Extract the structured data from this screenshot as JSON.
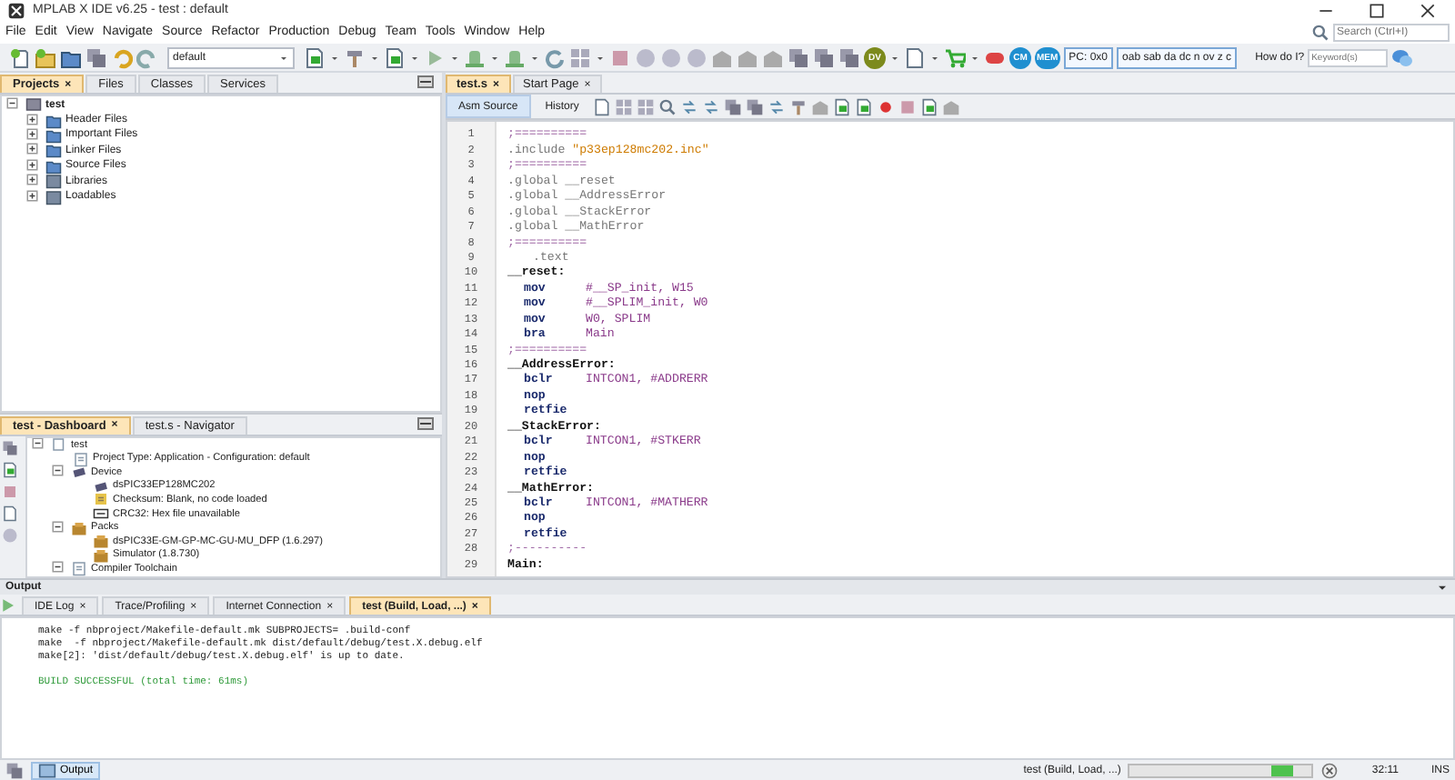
{
  "window": {
    "title": "MPLAB X IDE v6.25 - test : default"
  },
  "menu": [
    "File",
    "Edit",
    "View",
    "Navigate",
    "Source",
    "Refactor",
    "Production",
    "Debug",
    "Team",
    "Tools",
    "Window",
    "Help"
  ],
  "search": {
    "placeholder": "Search (Ctrl+I)"
  },
  "toolbar": {
    "configuration": "default",
    "badges": [
      "DV",
      "CM",
      "MEM"
    ],
    "pc": "PC: 0x0",
    "status_flags": "oab sab da dc n ov z c",
    "help_label": "How do I?",
    "help_placeholder": "Keyword(s)"
  },
  "projects_panel": {
    "tabs": [
      {
        "label": "Projects",
        "selected": true,
        "close": "×"
      },
      {
        "label": "Files",
        "selected": false
      },
      {
        "label": "Classes",
        "selected": false
      },
      {
        "label": "Services",
        "selected": false
      }
    ],
    "tree": {
      "label": "test",
      "kind": "project",
      "expanded": true,
      "children": [
        {
          "label": "Header Files",
          "kind": "folder",
          "expanded": false
        },
        {
          "label": "Important Files",
          "kind": "folder",
          "expanded": false
        },
        {
          "label": "Linker Files",
          "kind": "folder",
          "expanded": false
        },
        {
          "label": "Source Files",
          "kind": "folder",
          "expanded": false
        },
        {
          "label": "Libraries",
          "kind": "library",
          "expanded": false
        },
        {
          "label": "Loadables",
          "kind": "library",
          "expanded": false
        }
      ]
    }
  },
  "dashboard_panel": {
    "tabs": [
      {
        "label": "test - Dashboard",
        "selected": true,
        "close": "×"
      },
      {
        "label": "test.s - Navigator",
        "selected": false
      }
    ],
    "tree": {
      "label": "test",
      "kind": "root",
      "expanded": true,
      "children": [
        {
          "label": "Project Type: Application - Configuration: default",
          "kind": "info"
        },
        {
          "label": "Device",
          "kind": "chip",
          "expanded": true,
          "children": [
            {
              "label": "dsPIC33EP128MC202",
              "kind": "chip"
            },
            {
              "label": "Checksum: Blank, no code loaded",
              "kind": "checksum"
            },
            {
              "label": "CRC32: Hex file unavailable",
              "kind": "crc"
            }
          ]
        },
        {
          "label": "Packs",
          "kind": "pack",
          "expanded": true,
          "children": [
            {
              "label": "dsPIC33E-GM-GP-MC-GU-MU_DFP (1.6.297)",
              "kind": "pack"
            },
            {
              "label": "Simulator (1.8.730)",
              "kind": "pack"
            }
          ]
        },
        {
          "label": "Compiler Toolchain",
          "kind": "info",
          "expanded": true
        }
      ]
    }
  },
  "editor": {
    "tabs": [
      {
        "label": "test.s",
        "selected": true,
        "close": "×"
      },
      {
        "label": "Start Page",
        "selected": false,
        "close": "×"
      }
    ],
    "views": [
      {
        "label": "Asm Source",
        "selected": true
      },
      {
        "label": "History",
        "selected": false
      }
    ],
    "lines": [
      {
        "number": "1",
        "kind": "comment",
        "text": ";=========="
      },
      {
        "number": "2",
        "kind": "include",
        "directive": ".include",
        "argument": "\"p33ep128mc202.inc\""
      },
      {
        "number": "3",
        "kind": "comment",
        "text": ";=========="
      },
      {
        "number": "4",
        "kind": "directive",
        "text": ".global __reset"
      },
      {
        "number": "5",
        "kind": "directive",
        "text": ".global __AddressError"
      },
      {
        "number": "6",
        "kind": "directive",
        "text": ".global __StackError"
      },
      {
        "number": "7",
        "kind": "directive",
        "text": ".global __MathError"
      },
      {
        "number": "8",
        "kind": "comment",
        "text": ";=========="
      },
      {
        "number": "9",
        "kind": "section",
        "text": ".text"
      },
      {
        "number": "10",
        "kind": "label",
        "text": "__reset:"
      },
      {
        "number": "11",
        "kind": "instr",
        "mnemonic": "mov",
        "operands": "#__SP_init, W15"
      },
      {
        "number": "12",
        "kind": "instr",
        "mnemonic": "mov",
        "operands": "#__SPLIM_init, W0"
      },
      {
        "number": "13",
        "kind": "instr",
        "mnemonic": "mov",
        "operands": "W0, SPLIM"
      },
      {
        "number": "14",
        "kind": "instr",
        "mnemonic": "bra",
        "operands": "Main"
      },
      {
        "number": "15",
        "kind": "comment",
        "text": ";=========="
      },
      {
        "number": "16",
        "kind": "label",
        "text": "__AddressError:"
      },
      {
        "number": "17",
        "kind": "instr",
        "mnemonic": "bclr",
        "operands": "INTCON1, #ADDRERR"
      },
      {
        "number": "18",
        "kind": "instr",
        "mnemonic": "nop"
      },
      {
        "number": "19",
        "kind": "instr",
        "mnemonic": "retfie"
      },
      {
        "number": "20",
        "kind": "label",
        "text": "__StackError:"
      },
      {
        "number": "21",
        "kind": "instr",
        "mnemonic": "bclr",
        "operands": "INTCON1, #STKERR"
      },
      {
        "number": "22",
        "kind": "instr",
        "mnemonic": "nop"
      },
      {
        "number": "23",
        "kind": "instr",
        "mnemonic": "retfie"
      },
      {
        "number": "24",
        "kind": "label",
        "text": "__MathError:"
      },
      {
        "number": "25",
        "kind": "instr",
        "mnemonic": "bclr",
        "operands": "INTCON1, #MATHERR"
      },
      {
        "number": "26",
        "kind": "instr",
        "mnemonic": "nop"
      },
      {
        "number": "27",
        "kind": "instr",
        "mnemonic": "retfie"
      },
      {
        "number": "28",
        "kind": "comment",
        "text": ";----------"
      },
      {
        "number": "29",
        "kind": "label",
        "text": "Main:"
      }
    ]
  },
  "output": {
    "title": "Output",
    "tabs": [
      {
        "label": "IDE Log",
        "selected": false,
        "close": "×"
      },
      {
        "label": "Trace/Profiling",
        "selected": false,
        "close": "×"
      },
      {
        "label": "Internet Connection",
        "selected": false,
        "close": "×"
      },
      {
        "label": "test (Build, Load, ...)",
        "selected": true,
        "close": "×"
      }
    ],
    "lines": [
      {
        "kind": "plain",
        "text": "make -f nbproject/Makefile-default.mk SUBPROJECTS= .build-conf"
      },
      {
        "kind": "plain",
        "text": "make  -f nbproject/Makefile-default.mk dist/default/debug/test.X.debug.elf"
      },
      {
        "kind": "plain",
        "text": "make[2]: 'dist/default/debug/test.X.debug.elf' is up to date."
      },
      {
        "kind": "success",
        "text": "BUILD SUCCESSFUL (total time: 61ms)"
      }
    ]
  },
  "status_bar": {
    "output_button": "Output",
    "task": "test (Build, Load, ...)",
    "position": "32:11",
    "mode": "INS"
  }
}
